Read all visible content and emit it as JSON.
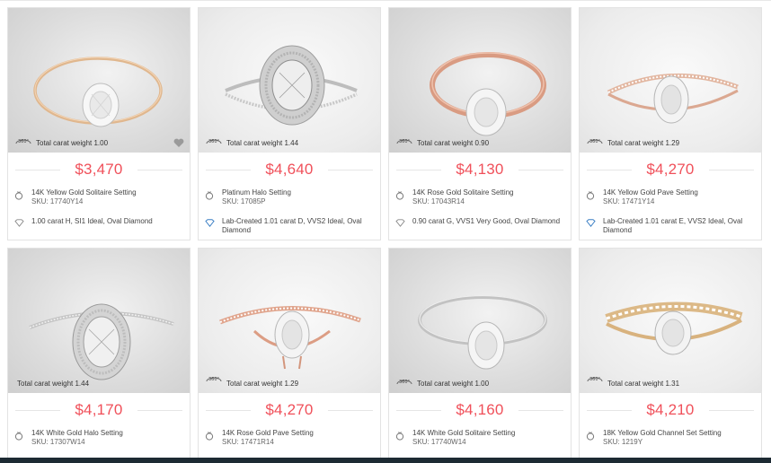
{
  "accent_price_color": "#f0505a",
  "cards": [
    {
      "total_carat": "Total carat weight 1.00",
      "price": "$3,470",
      "setting": "14K Yellow Gold Solitaire Setting",
      "sku": "SKU: 17740Y14",
      "diamond": "1.00 carat H, SI1 Ideal, Oval Diamond",
      "diamond_icon": "diamond-outline-icon",
      "metal": "yellow"
    },
    {
      "total_carat": "Total carat weight 1.44",
      "price": "$4,640",
      "setting": "Platinum Halo Setting",
      "sku": "SKU: 17085P",
      "diamond": "Lab-Created 1.01 carat D, VVS2 Ideal, Oval Diamond",
      "diamond_icon": "lab-diamond-icon",
      "metal": "white"
    },
    {
      "total_carat": "Total carat weight 0.90",
      "price": "$4,130",
      "setting": "14K Rose Gold Solitaire Setting",
      "sku": "SKU: 17043R14",
      "diamond": "0.90 carat G, VVS1 Very Good, Oval Diamond",
      "diamond_icon": "diamond-outline-icon",
      "metal": "rose"
    },
    {
      "total_carat": "Total carat weight 1.29",
      "price": "$4,270",
      "setting": "14K Yellow Gold Pave Setting",
      "sku": "SKU: 17471Y14",
      "diamond": "Lab-Created 1.01 carat E, VVS2 Ideal, Oval Diamond",
      "diamond_icon": "lab-diamond-icon",
      "metal": "rosepave"
    },
    {
      "total_carat": "Total carat weight 1.44",
      "price": "$4,170",
      "setting": "14K White Gold Halo Setting",
      "sku": "SKU: 17307W14",
      "metal": "white"
    },
    {
      "total_carat": "Total carat weight 1.29",
      "price": "$4,270",
      "setting": "14K Rose Gold Pave Setting",
      "sku": "SKU: 17471R14",
      "metal": "rose"
    },
    {
      "total_carat": "Total carat weight 1.00",
      "price": "$4,160",
      "setting": "14K White Gold Solitaire Setting",
      "sku": "SKU: 17740W14",
      "metal": "white"
    },
    {
      "total_carat": "Total carat weight 1.31",
      "price": "$4,210",
      "setting": "18K Yellow Gold Channel Set Setting",
      "sku": "SKU: 1219Y",
      "metal": "yellow"
    }
  ]
}
